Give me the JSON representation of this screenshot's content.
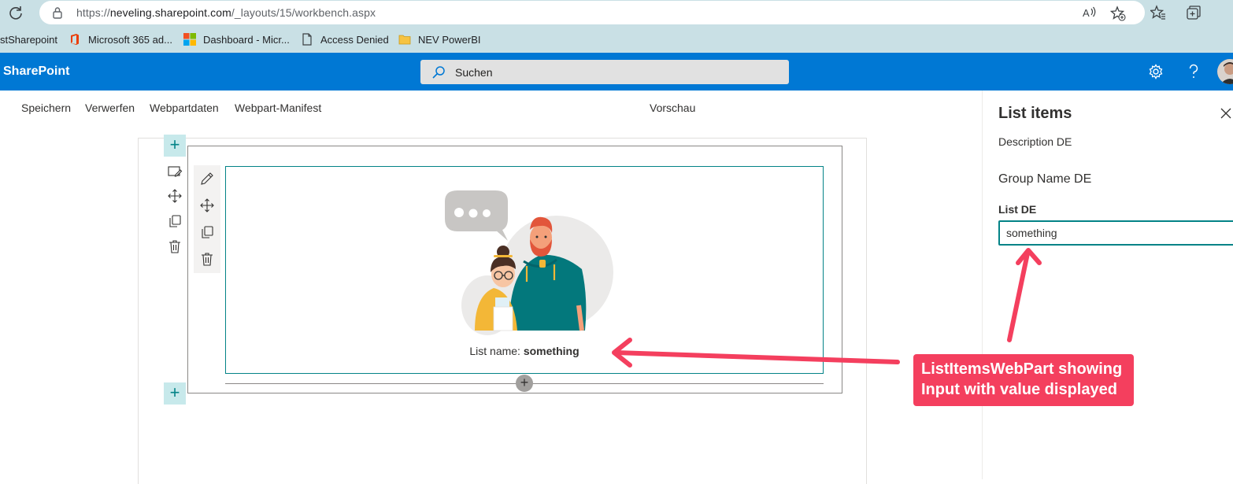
{
  "browser": {
    "url_prefix": "https://",
    "url_host": "neveling.sharepoint.com",
    "url_path": "/_layouts/15/workbench.aspx",
    "bookmarks": [
      "stSharepoint",
      "Microsoft 365 ad...",
      "Dashboard - Micr...",
      "Access Denied",
      "NEV PowerBI"
    ]
  },
  "suitebar": {
    "brand": "SharePoint",
    "search_placeholder": "Suchen"
  },
  "commandbar": {
    "save": "Speichern",
    "discard": "Verwerfen",
    "webpart_data": "Webpartdaten",
    "webpart_manifest": "Webpart-Manifest",
    "preview": "Vorschau"
  },
  "webpart": {
    "list_name_label": "List name:",
    "list_name_value": "something"
  },
  "property_pane": {
    "title": "List items",
    "description": "Description DE",
    "group_name": "Group Name DE",
    "field_label": "List DE",
    "field_value": "something"
  },
  "annotation": {
    "line1": "ListItemsWebPart showing",
    "line2": "Input with value displayed"
  },
  "colors": {
    "suitebar": "#0078d4",
    "accent_teal": "#038387",
    "annotation": "#f43f5e",
    "browser_chrome": "#c9e0e5"
  }
}
